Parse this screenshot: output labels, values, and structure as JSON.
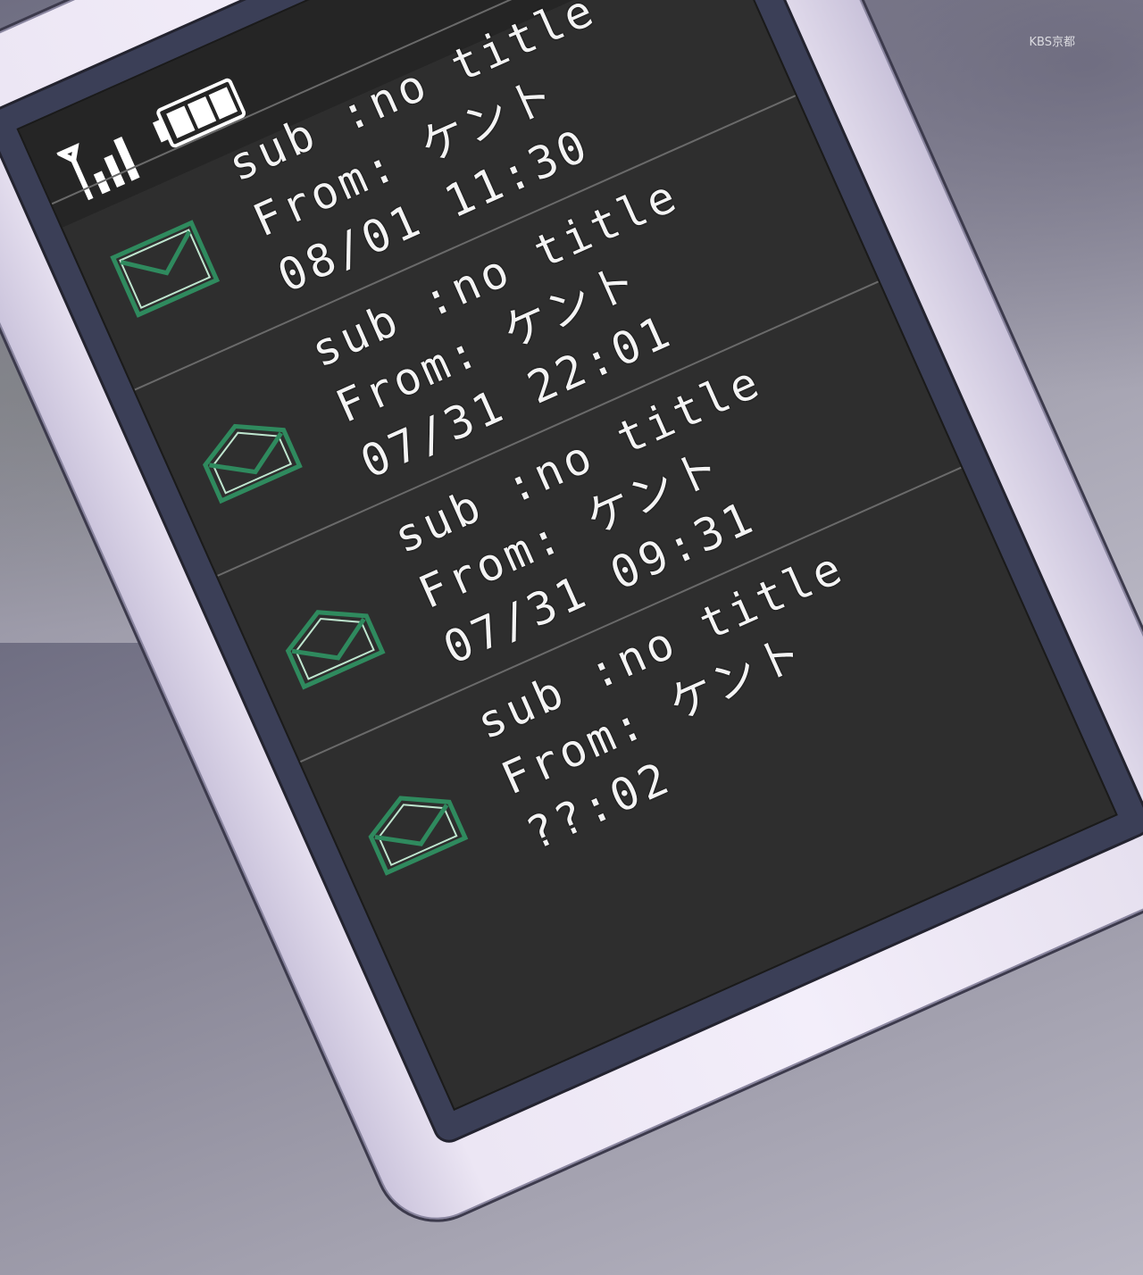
{
  "watermark": "KBS京都",
  "status": {
    "signal_icon": "signal-strength-icon",
    "battery_icon": "battery-icon"
  },
  "messages": [
    {
      "subject": "sub :no title",
      "from": "From: ケント",
      "datetime": "08/01 11:30",
      "icon": "unread-envelope-icon"
    },
    {
      "subject": "sub :no title",
      "from": "From: ケント",
      "datetime": "07/31 22:01",
      "icon": "opened-envelope-icon"
    },
    {
      "subject": "sub :no title",
      "from": "From: ケント",
      "datetime": "07/31 09:31",
      "icon": "opened-envelope-icon"
    },
    {
      "subject": "sub :no title",
      "from": "From: ケント",
      "datetime": "??:02",
      "icon": "opened-envelope-icon"
    }
  ],
  "colors": {
    "screen": "#2e2e2e",
    "text": "#f4f4f4",
    "envelope": "#2f8a5e",
    "divider": "#6a6a6a"
  }
}
